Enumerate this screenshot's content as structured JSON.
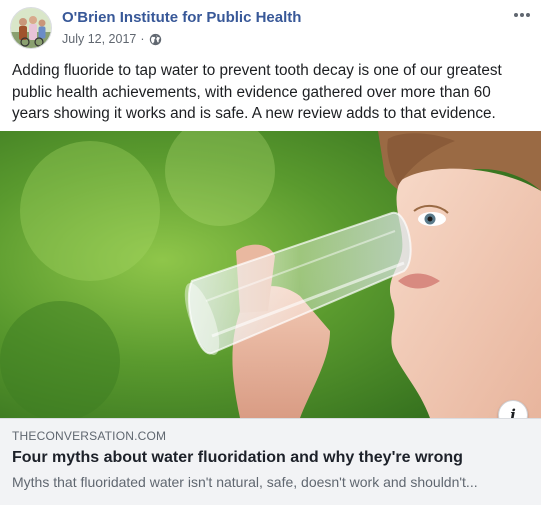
{
  "post": {
    "page_name": "O'Brien Institute for Public Health",
    "date": "July 12, 2017",
    "separator": "·",
    "privacy_icon": "globe-icon",
    "more_icon": "more-options-icon",
    "text": "Adding fluoride to tap water to prevent tooth decay is one of our greatest public health achievements, with evidence gathered over more than 60 years showing it works and is safe. A new review adds to that evidence."
  },
  "link_preview": {
    "domain": "THECONVERSATION.COM",
    "title": "Four myths about water fluoridation and why they're wrong",
    "description": "Myths that fluoridated water isn't natural, safe, doesn't work and shouldn't...",
    "info_icon": "info-icon",
    "info_label": "i"
  },
  "colors": {
    "page_name": "#385898",
    "meta_text": "#606770",
    "body_text": "#1c1e21",
    "preview_bg": "#f2f3f5"
  }
}
